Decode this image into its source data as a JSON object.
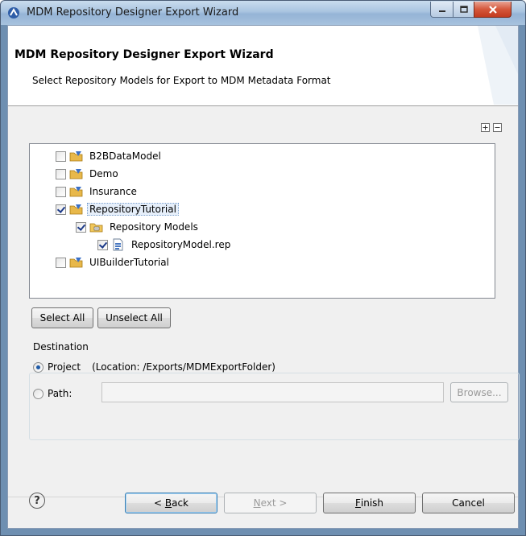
{
  "window": {
    "title": "MDM Repository Designer Export Wizard"
  },
  "banner": {
    "title": "MDM Repository Designer Export Wizard",
    "description": "Select Repository Models for Export to MDM Metadata Format"
  },
  "tree": {
    "items": [
      {
        "label": "B2BDataModel",
        "checked": false,
        "icon": "project-folder-icon"
      },
      {
        "label": "Demo",
        "checked": false,
        "icon": "project-folder-icon"
      },
      {
        "label": "Insurance",
        "checked": false,
        "icon": "project-folder-icon"
      },
      {
        "label": "RepositoryTutorial",
        "checked": true,
        "icon": "project-folder-icon",
        "selected": true
      },
      {
        "label": "Repository Models",
        "checked": true,
        "icon": "models-folder-icon"
      },
      {
        "label": "RepositoryModel.rep",
        "checked": true,
        "icon": "repository-file-icon"
      },
      {
        "label": "UIBuilderTutorial",
        "checked": false,
        "icon": "project-folder-icon"
      }
    ]
  },
  "selection": {
    "select_all": "Select All",
    "unselect_all": "Unselect All"
  },
  "destination": {
    "label": "Destination",
    "project_label": "Project",
    "project_location": "(Location: /Exports/MDMExportFolder)",
    "path_label": "Path:",
    "path_value": "",
    "browse_label": "Browse...",
    "selected": "project"
  },
  "footer": {
    "help": "?",
    "back_prefix": "< ",
    "back_mnemonic": "B",
    "back_rest": "ack",
    "next_mnemonic": "N",
    "next_rest": "ext >",
    "finish_mnemonic": "F",
    "finish_rest": "inish",
    "cancel": "Cancel"
  },
  "colors": {
    "accent": "#3c7fb1",
    "folder": "#e8b84a",
    "project_badge": "#3a6fc4"
  }
}
